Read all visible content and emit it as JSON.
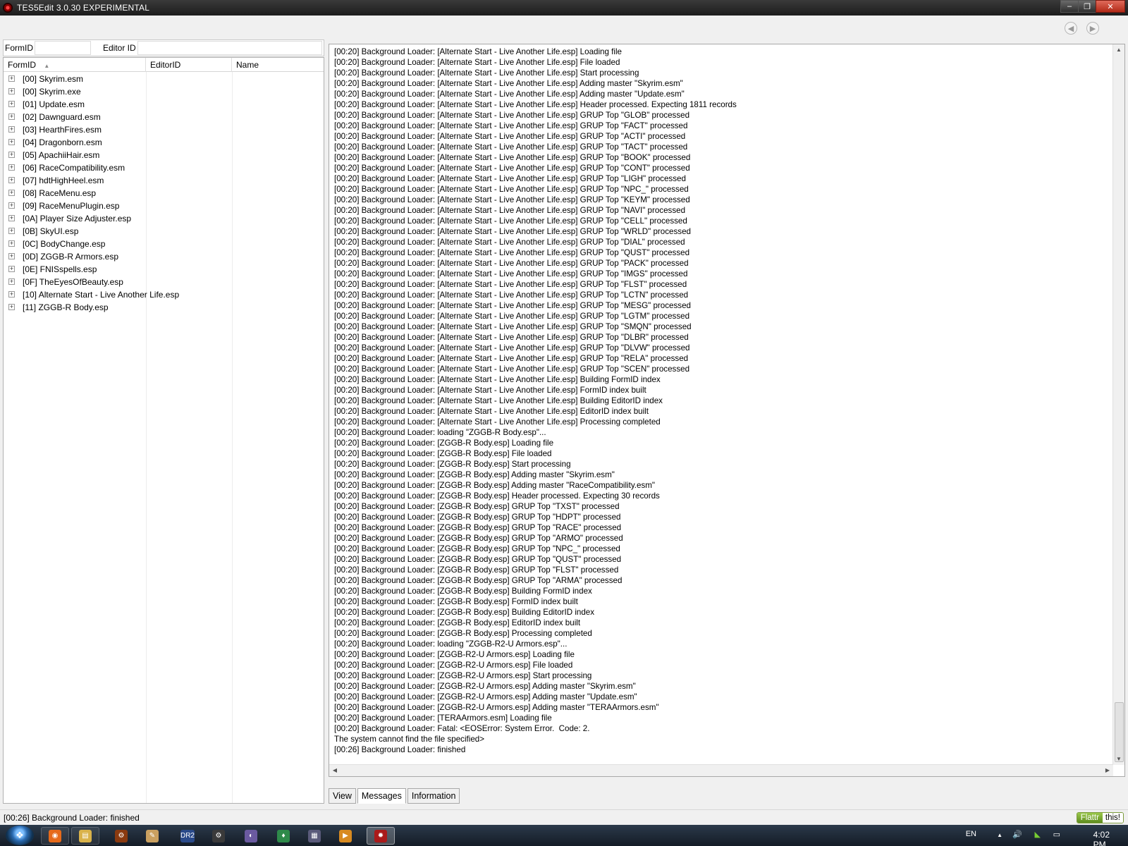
{
  "window": {
    "title": "TES5Edit 3.0.30 EXPERIMENTAL",
    "minimize": "‒",
    "maximize": "❐",
    "close": "✕"
  },
  "nav": {
    "back": "◀",
    "forward": "▶"
  },
  "filter": {
    "formid_label": "FormID",
    "formid_value": "",
    "editorid_label": "Editor ID",
    "editorid_value": ""
  },
  "tree": {
    "columns": [
      "FormID",
      "EditorID",
      "Name"
    ],
    "sort_indicator": "▲",
    "expander": "+",
    "rows": [
      "[00] Skyrim.esm",
      "[00] Skyrim.exe",
      "[01] Update.esm",
      "[02] Dawnguard.esm",
      "[03] HearthFires.esm",
      "[04] Dragonborn.esm",
      "[05] ApachiiHair.esm",
      "[06] RaceCompatibility.esm",
      "[07] hdtHighHeel.esm",
      "[08] RaceMenu.esp",
      "[09] RaceMenuPlugin.esp",
      "[0A] Player Size Adjuster.esp",
      "[0B] SkyUI.esp",
      "[0C] BodyChange.esp",
      "[0D] ZGGB-R Armors.esp",
      "[0E] FNISspells.esp",
      "[0F] TheEyesOfBeauty.esp",
      "[10] Alternate Start - Live Another Life.esp",
      "[11] ZGGB-R Body.esp"
    ]
  },
  "messages": [
    "[00:20] Background Loader: [Alternate Start - Live Another Life.esp] Loading file",
    "[00:20] Background Loader: [Alternate Start - Live Another Life.esp] File loaded",
    "[00:20] Background Loader: [Alternate Start - Live Another Life.esp] Start processing",
    "[00:20] Background Loader: [Alternate Start - Live Another Life.esp] Adding master \"Skyrim.esm\"",
    "[00:20] Background Loader: [Alternate Start - Live Another Life.esp] Adding master \"Update.esm\"",
    "[00:20] Background Loader: [Alternate Start - Live Another Life.esp] Header processed. Expecting 1811 records",
    "[00:20] Background Loader: [Alternate Start - Live Another Life.esp] GRUP Top \"GLOB\" processed",
    "[00:20] Background Loader: [Alternate Start - Live Another Life.esp] GRUP Top \"FACT\" processed",
    "[00:20] Background Loader: [Alternate Start - Live Another Life.esp] GRUP Top \"ACTI\" processed",
    "[00:20] Background Loader: [Alternate Start - Live Another Life.esp] GRUP Top \"TACT\" processed",
    "[00:20] Background Loader: [Alternate Start - Live Another Life.esp] GRUP Top \"BOOK\" processed",
    "[00:20] Background Loader: [Alternate Start - Live Another Life.esp] GRUP Top \"CONT\" processed",
    "[00:20] Background Loader: [Alternate Start - Live Another Life.esp] GRUP Top \"LIGH\" processed",
    "[00:20] Background Loader: [Alternate Start - Live Another Life.esp] GRUP Top \"NPC_\" processed",
    "[00:20] Background Loader: [Alternate Start - Live Another Life.esp] GRUP Top \"KEYM\" processed",
    "[00:20] Background Loader: [Alternate Start - Live Another Life.esp] GRUP Top \"NAVI\" processed",
    "[00:20] Background Loader: [Alternate Start - Live Another Life.esp] GRUP Top \"CELL\" processed",
    "[00:20] Background Loader: [Alternate Start - Live Another Life.esp] GRUP Top \"WRLD\" processed",
    "[00:20] Background Loader: [Alternate Start - Live Another Life.esp] GRUP Top \"DIAL\" processed",
    "[00:20] Background Loader: [Alternate Start - Live Another Life.esp] GRUP Top \"QUST\" processed",
    "[00:20] Background Loader: [Alternate Start - Live Another Life.esp] GRUP Top \"PACK\" processed",
    "[00:20] Background Loader: [Alternate Start - Live Another Life.esp] GRUP Top \"IMGS\" processed",
    "[00:20] Background Loader: [Alternate Start - Live Another Life.esp] GRUP Top \"FLST\" processed",
    "[00:20] Background Loader: [Alternate Start - Live Another Life.esp] GRUP Top \"LCTN\" processed",
    "[00:20] Background Loader: [Alternate Start - Live Another Life.esp] GRUP Top \"MESG\" processed",
    "[00:20] Background Loader: [Alternate Start - Live Another Life.esp] GRUP Top \"LGTM\" processed",
    "[00:20] Background Loader: [Alternate Start - Live Another Life.esp] GRUP Top \"SMQN\" processed",
    "[00:20] Background Loader: [Alternate Start - Live Another Life.esp] GRUP Top \"DLBR\" processed",
    "[00:20] Background Loader: [Alternate Start - Live Another Life.esp] GRUP Top \"DLVW\" processed",
    "[00:20] Background Loader: [Alternate Start - Live Another Life.esp] GRUP Top \"RELA\" processed",
    "[00:20] Background Loader: [Alternate Start - Live Another Life.esp] GRUP Top \"SCEN\" processed",
    "[00:20] Background Loader: [Alternate Start - Live Another Life.esp] Building FormID index",
    "[00:20] Background Loader: [Alternate Start - Live Another Life.esp] FormID index built",
    "[00:20] Background Loader: [Alternate Start - Live Another Life.esp] Building EditorID index",
    "[00:20] Background Loader: [Alternate Start - Live Another Life.esp] EditorID index built",
    "[00:20] Background Loader: [Alternate Start - Live Another Life.esp] Processing completed",
    "[00:20] Background Loader: loading \"ZGGB-R Body.esp\"...",
    "[00:20] Background Loader: [ZGGB-R Body.esp] Loading file",
    "[00:20] Background Loader: [ZGGB-R Body.esp] File loaded",
    "[00:20] Background Loader: [ZGGB-R Body.esp] Start processing",
    "[00:20] Background Loader: [ZGGB-R Body.esp] Adding master \"Skyrim.esm\"",
    "[00:20] Background Loader: [ZGGB-R Body.esp] Adding master \"RaceCompatibility.esm\"",
    "[00:20] Background Loader: [ZGGB-R Body.esp] Header processed. Expecting 30 records",
    "[00:20] Background Loader: [ZGGB-R Body.esp] GRUP Top \"TXST\" processed",
    "[00:20] Background Loader: [ZGGB-R Body.esp] GRUP Top \"HDPT\" processed",
    "[00:20] Background Loader: [ZGGB-R Body.esp] GRUP Top \"RACE\" processed",
    "[00:20] Background Loader: [ZGGB-R Body.esp] GRUP Top \"ARMO\" processed",
    "[00:20] Background Loader: [ZGGB-R Body.esp] GRUP Top \"NPC_\" processed",
    "[00:20] Background Loader: [ZGGB-R Body.esp] GRUP Top \"QUST\" processed",
    "[00:20] Background Loader: [ZGGB-R Body.esp] GRUP Top \"FLST\" processed",
    "[00:20] Background Loader: [ZGGB-R Body.esp] GRUP Top \"ARMA\" processed",
    "[00:20] Background Loader: [ZGGB-R Body.esp] Building FormID index",
    "[00:20] Background Loader: [ZGGB-R Body.esp] FormID index built",
    "[00:20] Background Loader: [ZGGB-R Body.esp] Building EditorID index",
    "[00:20] Background Loader: [ZGGB-R Body.esp] EditorID index built",
    "[00:20] Background Loader: [ZGGB-R Body.esp] Processing completed",
    "[00:20] Background Loader: loading \"ZGGB-R2-U Armors.esp\"...",
    "[00:20] Background Loader: [ZGGB-R2-U Armors.esp] Loading file",
    "[00:20] Background Loader: [ZGGB-R2-U Armors.esp] File loaded",
    "[00:20] Background Loader: [ZGGB-R2-U Armors.esp] Start processing",
    "[00:20] Background Loader: [ZGGB-R2-U Armors.esp] Adding master \"Skyrim.esm\"",
    "[00:20] Background Loader: [ZGGB-R2-U Armors.esp] Adding master \"Update.esm\"",
    "[00:20] Background Loader: [ZGGB-R2-U Armors.esp] Adding master \"TERAArmors.esm\"",
    "[00:20] Background Loader: [TERAArmors.esm] Loading file",
    "[00:20] Background Loader: Fatal: <EOSError: System Error.  Code: 2.",
    "The system cannot find the file specified>",
    "[00:26] Background Loader: finished"
  ],
  "scroll": {
    "up": "▲",
    "down": "▼",
    "left": "◀",
    "right": "▶"
  },
  "tabs": [
    "View",
    "Messages",
    "Information"
  ],
  "active_tab": "Messages",
  "status": {
    "text": "[00:26] Background Loader: finished",
    "flattr_left": "Flattr",
    "flattr_right": "this!"
  },
  "taskbar": {
    "apps": [
      "firefox-icon",
      "explorer-icon",
      "diablo-icon",
      "script-icon",
      "dr2-icon",
      "steam-icon",
      "eclipse-icon",
      "game-icon",
      "photo-icon",
      "media-icon",
      "tes5edit-icon"
    ],
    "app_glyphs": [
      "◉",
      "▤",
      "⚙",
      "✎",
      "DR2",
      "⚙",
      "◐",
      "♦",
      "▦",
      "▶",
      "✹"
    ],
    "start_glyph": "❖"
  },
  "tray": {
    "language": "EN",
    "up_arrow": "▲",
    "volume": "🔊",
    "gpu": "◣",
    "network": "▭",
    "time": "4:02 PM"
  }
}
